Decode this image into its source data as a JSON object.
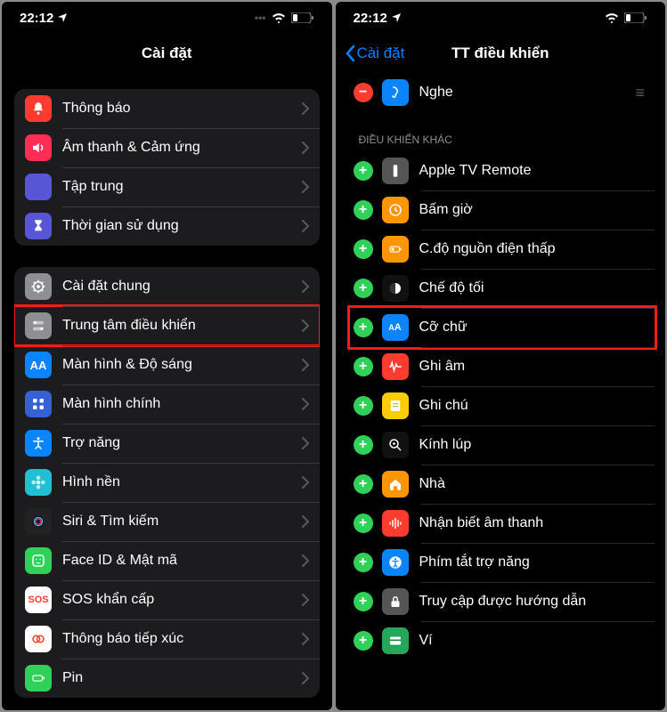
{
  "status": {
    "time": "22:12"
  },
  "phone1": {
    "title": "Cài đặt",
    "group1": [
      {
        "label": "Thông báo",
        "bg": "#ff3b30",
        "icon": "bell"
      },
      {
        "label": "Âm thanh & Cảm ứng",
        "bg": "#ff2d55",
        "icon": "speaker"
      },
      {
        "label": "Tập trung",
        "bg": "#5856d6",
        "icon": "moon"
      },
      {
        "label": "Thời gian sử dụng",
        "bg": "#5856d6",
        "icon": "hourglass"
      }
    ],
    "group2": [
      {
        "label": "Cài đặt chung",
        "bg": "#8e8e93",
        "icon": "gear"
      },
      {
        "label": "Trung tâm điều khiển",
        "bg": "#8e8e93",
        "icon": "switches",
        "hl": true
      },
      {
        "label": "Màn hình & Độ sáng",
        "bg": "#0a84ff",
        "icon": "aa"
      },
      {
        "label": "Màn hình chính",
        "bg": "#3561d4",
        "icon": "grid"
      },
      {
        "label": "Trợ năng",
        "bg": "#0a84ff",
        "icon": "access"
      },
      {
        "label": "Hình nền",
        "bg": "#21bfd3",
        "icon": "flower"
      },
      {
        "label": "Siri & Tìm kiếm",
        "bg": "#222",
        "icon": "siri"
      },
      {
        "label": "Face ID & Mật mã",
        "bg": "#30d158",
        "icon": "faceid"
      },
      {
        "label": "SOS khẩn cấp",
        "bg": "#fff",
        "icon": "sos"
      },
      {
        "label": "Thông báo tiếp xúc",
        "bg": "#fff",
        "icon": "exposure"
      },
      {
        "label": "Pin",
        "bg": "#30d158",
        "icon": "battery"
      }
    ]
  },
  "phone2": {
    "back": "Cài đặt",
    "title": "TT điều khiển",
    "included": [
      {
        "label": "Nghe",
        "bg": "#0a84ff",
        "icon": "ear",
        "action": "remove"
      }
    ],
    "more_header": "ĐIỀU KHIỂN KHÁC",
    "more": [
      {
        "label": "Apple TV Remote",
        "bg": "#555",
        "icon": "remote"
      },
      {
        "label": "Bấm giờ",
        "bg": "#ff9500",
        "icon": "clock"
      },
      {
        "label": "C.độ nguồn điện thấp",
        "bg": "#ff9500",
        "icon": "battlow"
      },
      {
        "label": "Chế độ tối",
        "bg": "#111",
        "icon": "darkmode"
      },
      {
        "label": "Cỡ chữ",
        "bg": "#0a84ff",
        "icon": "textsize",
        "hl": true
      },
      {
        "label": "Ghi âm",
        "bg": "#ff3b30",
        "icon": "wave"
      },
      {
        "label": "Ghi chú",
        "bg": "#ffcc00",
        "icon": "note"
      },
      {
        "label": "Kính lúp",
        "bg": "#111",
        "icon": "magnify"
      },
      {
        "label": "Nhà",
        "bg": "#ff9500",
        "icon": "home"
      },
      {
        "label": "Nhận biết âm thanh",
        "bg": "#ff3b30",
        "icon": "soundwave"
      },
      {
        "label": "Phím tắt trợ năng",
        "bg": "#0a84ff",
        "icon": "access2"
      },
      {
        "label": "Truy cập được hướng dẫn",
        "bg": "#555",
        "icon": "lock"
      },
      {
        "label": "Ví",
        "bg": "#26a65b",
        "icon": "wallet"
      }
    ]
  }
}
